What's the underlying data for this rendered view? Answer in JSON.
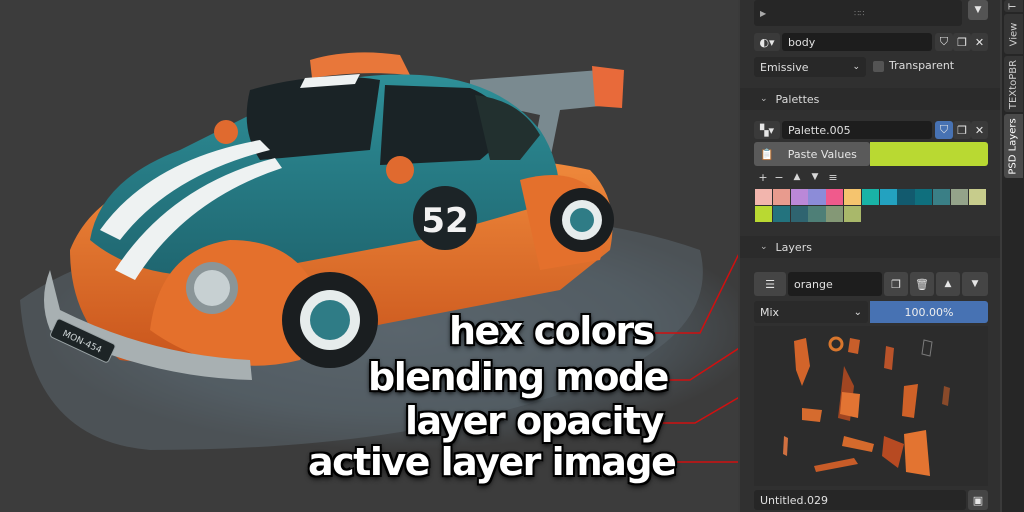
{
  "material": {
    "name": "body",
    "blend_mode": "Emissive",
    "transparent_label": "Transparent",
    "transparent_checked": false
  },
  "palettes": {
    "header": "Palettes",
    "palette_name": "Palette.005",
    "paste_label": "Paste Values",
    "active_color": "#b9d932",
    "swatches": [
      "#f2b5ad",
      "#e89b8e",
      "#bb88d8",
      "#8c8cd8",
      "#f05a8c",
      "#f5c46e",
      "#19b3a6",
      "#23a2c0",
      "#125a6e",
      "#0f6f7d",
      "#3a7f86",
      "#94a38a",
      "#c7cc8c",
      "#b9d932",
      "#23737e",
      "#2f6470",
      "#4e7f77",
      "#849876",
      "#a9b86a"
    ]
  },
  "layers": {
    "header": "Layers",
    "layer_name": "orange",
    "blend": "Mix",
    "opacity": "100.00%",
    "opacity_fraction": 1.0,
    "image_name": "Untitled.029"
  },
  "tabs": [
    "T",
    "View",
    "TEXtoPBR",
    "PSD Layers"
  ],
  "callouts": {
    "hex": "hex colors",
    "blend": "blending mode",
    "opacity": "layer opacity",
    "image": "active layer image"
  },
  "car": {
    "number": "52",
    "plate": "MON-454"
  }
}
